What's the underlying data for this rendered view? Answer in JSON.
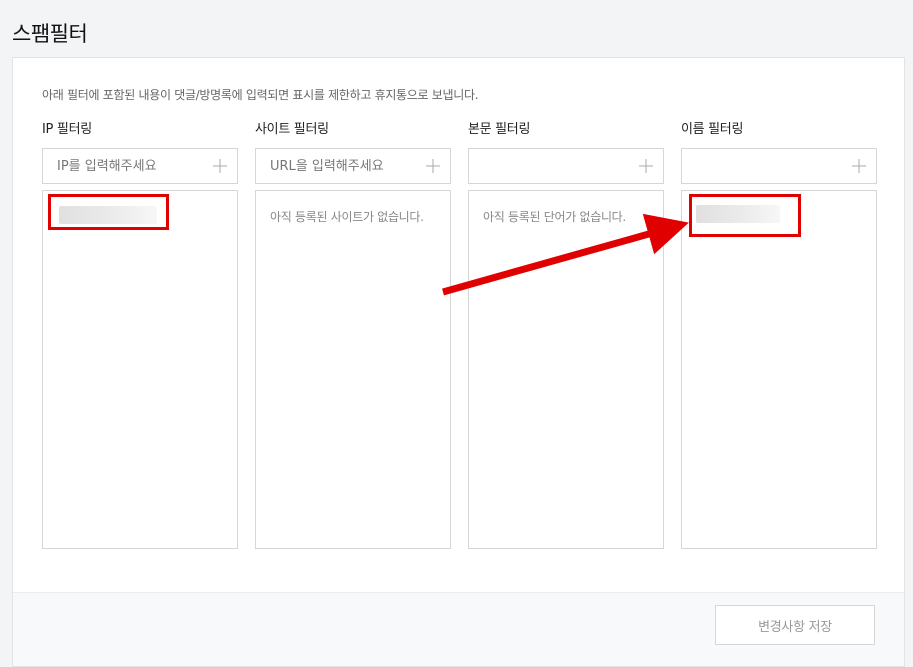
{
  "page": {
    "title": "스팸필터"
  },
  "description": "아래 필터에 포함된 내용이 댓글/방명록에 입력되면 표시를 제한하고 휴지통으로 보냅니다.",
  "filters": [
    {
      "title": "IP 필터링",
      "placeholder": "IP를 입력해주세요",
      "empty_text": ""
    },
    {
      "title": "사이트 필터링",
      "placeholder": "URL을 입력해주세요",
      "empty_text": "아직 등록된 사이트가 없습니다."
    },
    {
      "title": "본문 필터링",
      "placeholder": "",
      "empty_text": "아직 등록된 단어가 없습니다."
    },
    {
      "title": "이름 필터링",
      "placeholder": "",
      "empty_text": ""
    }
  ],
  "actions": {
    "save_label": "변경사항 저장"
  },
  "annotation": {
    "color": "#e00000"
  },
  "icons": {
    "add": "plus-icon"
  }
}
